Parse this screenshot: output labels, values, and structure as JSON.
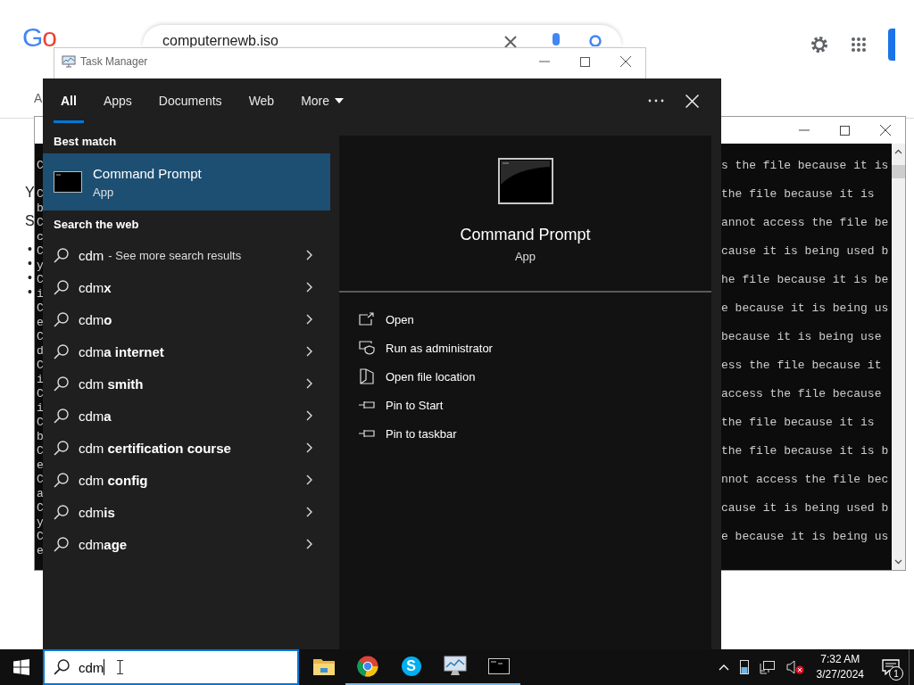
{
  "browser": {
    "logo": "Go",
    "search_value": "computernewb.iso",
    "tab_fragment": "A",
    "text_fragments": [
      "Y",
      "S"
    ],
    "bullets": [
      "•",
      "•",
      "•",
      "•"
    ]
  },
  "console_window": {
    "lines": [
      {
        "start": "C",
        "end": "s the file because it is"
      },
      {
        "start": "C",
        "end": "the file because it is",
        "wrap": "b"
      },
      {
        "start": "C",
        "end": "annot access the file be",
        "wrap": "c"
      },
      {
        "start": "C",
        "end": "cause it is being used b",
        "wrap": "y"
      },
      {
        "start": "C",
        "end": "he file because it is be",
        "wrap": "i"
      },
      {
        "start": "C",
        "end": "e because it is being us",
        "wrap": "e"
      },
      {
        "start": "C",
        "end": "because it is being use",
        "wrap": "d"
      },
      {
        "start": "C",
        "end": "ess the file because it",
        "wrap": "i"
      },
      {
        "start": "C",
        "end": "access the file because",
        "wrap": "i"
      },
      {
        "start": "C",
        "end": "the file because it is",
        "wrap": "b"
      },
      {
        "start": "C",
        "end": "the file because it is b",
        "wrap": "e"
      },
      {
        "start": "C",
        "end": "nnot access the file bec",
        "wrap": "a"
      },
      {
        "start": "C",
        "end": "cause it is being used b",
        "wrap": "y"
      },
      {
        "start": "C",
        "end": "e because it is being us",
        "wrap": "e"
      }
    ]
  },
  "task_manager": {
    "title": "Task Manager"
  },
  "search_menu": {
    "tabs": [
      {
        "label": "All",
        "selected": true,
        "dropdown": false
      },
      {
        "label": "Apps",
        "selected": false,
        "dropdown": false
      },
      {
        "label": "Documents",
        "selected": false,
        "dropdown": false
      },
      {
        "label": "Web",
        "selected": false,
        "dropdown": false
      },
      {
        "label": "More",
        "selected": false,
        "dropdown": true
      }
    ],
    "best_match_header": "Best match",
    "best_match": {
      "name": "Command Prompt",
      "type": "App",
      "selected": true
    },
    "web_header": "Search the web",
    "suggestions": [
      {
        "text": "cdm",
        "hint": "- See more search results"
      },
      {
        "text": "cdm**x**"
      },
      {
        "text": "cdm**o**"
      },
      {
        "text": "cdm**a internet**"
      },
      {
        "text": "cdm **smith**"
      },
      {
        "text": "cdm**a**"
      },
      {
        "text": "cdm **certification course**"
      },
      {
        "text": "cdm **config**"
      },
      {
        "text": "cdm**is**"
      },
      {
        "text": "cdm**age**"
      }
    ],
    "preview": {
      "name": "Command Prompt",
      "type": "App"
    },
    "actions": [
      {
        "label": "Open",
        "kind": "open"
      },
      {
        "label": "Run as administrator",
        "kind": "admin"
      },
      {
        "label": "Open file location",
        "kind": "location"
      },
      {
        "label": "Pin to Start",
        "kind": "pin"
      },
      {
        "label": "Pin to taskbar",
        "kind": "pin"
      }
    ]
  },
  "taskbar": {
    "search_value": "cdm",
    "pinned": [
      {
        "kind": "explorer",
        "running": false
      },
      {
        "kind": "chrome",
        "running": true
      },
      {
        "kind": "skype",
        "label": "S",
        "running": true
      },
      {
        "kind": "monitor",
        "running": true
      },
      {
        "kind": "console",
        "running": true
      }
    ],
    "volume_muted": true,
    "time": "7:32 AM",
    "date": "3/27/2024",
    "notification_count": "1"
  }
}
